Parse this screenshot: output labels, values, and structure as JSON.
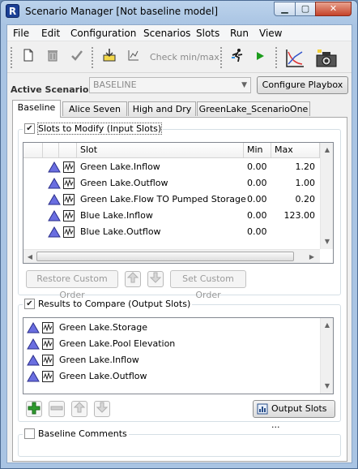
{
  "window": {
    "title": "Scenario Manager [Not baseline model]",
    "app_icon_letter": "R",
    "minimize_glyph": "▁",
    "maximize_glyph": "▢",
    "close_glyph": "✕"
  },
  "menu": [
    "File",
    "Edit",
    "Configuration",
    "Scenarios",
    "Slots",
    "Run",
    "View"
  ],
  "toolbar": {
    "new_icon": "new-document-icon",
    "delete_icon": "trash-icon",
    "check_icon": "checkmark-icon",
    "import_icon": "import-icon",
    "plot_icon": "plot-icon",
    "check_minmax_label": "Check min/max",
    "run_icon": "runner-icon",
    "play_icon": "play-icon",
    "graph_icon": "graph-icon",
    "snapshot_icon": "camera-icon"
  },
  "active_scenario": {
    "label": "Active Scenario:",
    "value": "BASELINE",
    "configure_button": "Configure Playbox ..."
  },
  "tabs": [
    "Baseline",
    "Alice Seven",
    "High and Dry",
    "GreenLake_ScenarioOne"
  ],
  "slots_to_modify": {
    "title": "Slots to Modify (Input Slots)",
    "checked": true,
    "columns": [
      "Slot",
      "Min",
      "Max"
    ],
    "rows": [
      {
        "slot": "Green Lake.Inflow",
        "min": "0.00",
        "max": "1.20"
      },
      {
        "slot": "Green Lake.Outflow",
        "min": "0.00",
        "max": "1.00"
      },
      {
        "slot": "Green Lake.Flow TO Pumped Storage",
        "min": "0.00",
        "max": "0.20"
      },
      {
        "slot": "Blue Lake.Inflow",
        "min": "0.00",
        "max": "123.00"
      },
      {
        "slot": "Blue Lake.Outflow",
        "min": "0.00",
        "max": ""
      }
    ],
    "restore_button": "Restore Custom Order",
    "set_button": "Set Custom Order"
  },
  "results_to_compare": {
    "title": "Results to Compare (Output Slots)",
    "checked": true,
    "items": [
      "Green Lake.Storage",
      "Green Lake.Pool Elevation",
      "Green Lake.Inflow",
      "Green Lake.Outflow"
    ],
    "output_slots_button": "Output Slots ..."
  },
  "baseline_comments": {
    "label": "Baseline Comments",
    "checked": false
  },
  "colors": {
    "accent_triangle": "#6a6ee0",
    "add_green": "#2e9b2e",
    "run_green": "#1c9c1c"
  }
}
